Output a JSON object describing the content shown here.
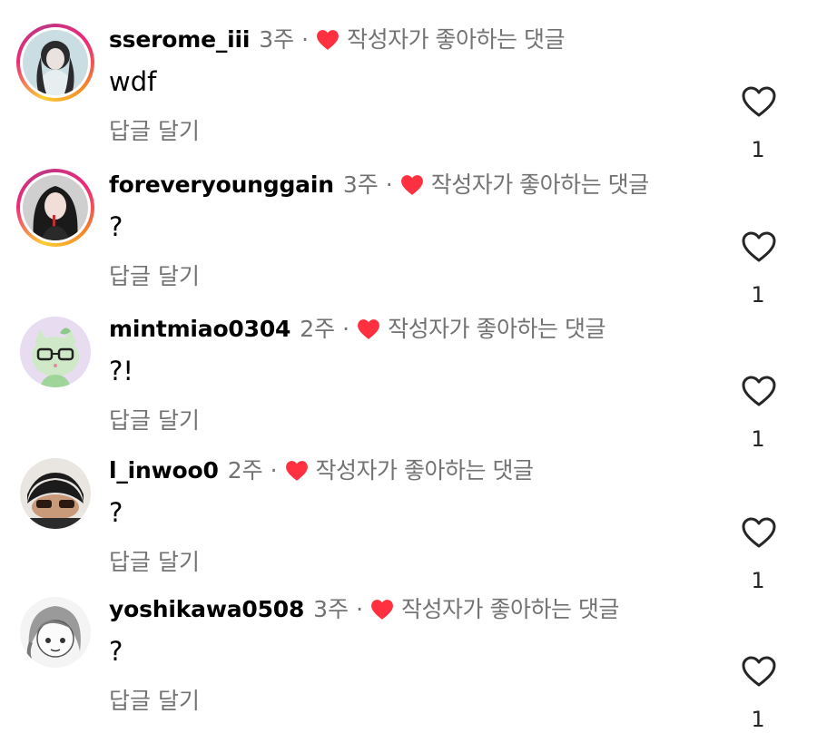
{
  "comments": [
    {
      "username": "sserome_iii",
      "time": "3주",
      "dot": "·",
      "liked_by_author_text": "작성자가 좋아하는 댓글",
      "text": "wdf",
      "reply_label": "답글 달기",
      "like_count": "1",
      "avatar_story_ring": true
    },
    {
      "username": "foreveryounggain",
      "time": "3주",
      "dot": "·",
      "liked_by_author_text": "작성자가 좋아하는 댓글",
      "text": "?",
      "reply_label": "답글 달기",
      "like_count": "1",
      "avatar_story_ring": true
    },
    {
      "username": "mintmiao0304",
      "time": "2주",
      "dot": "·",
      "liked_by_author_text": "작성자가 좋아하는 댓글",
      "text": "?!",
      "reply_label": "답글 달기",
      "like_count": "1",
      "avatar_story_ring": false
    },
    {
      "username": "l_inwoo0",
      "time": "2주",
      "dot": "·",
      "liked_by_author_text": "작성자가 좋아하는 댓글",
      "text": "?",
      "reply_label": "답글 달기",
      "like_count": "1",
      "avatar_story_ring": false
    },
    {
      "username": "yoshikawa0508",
      "time": "3주",
      "dot": "·",
      "liked_by_author_text": "작성자가 좋아하는 댓글",
      "text": "?",
      "reply_label": "답글 달기",
      "like_count": "1",
      "avatar_story_ring": false
    }
  ],
  "colors": {
    "heart_red": "#ff3040",
    "secondary_text": "#737373"
  },
  "icons": {
    "liked_by_author": "heart-filled-icon",
    "like_button": "heart-outline-icon"
  }
}
